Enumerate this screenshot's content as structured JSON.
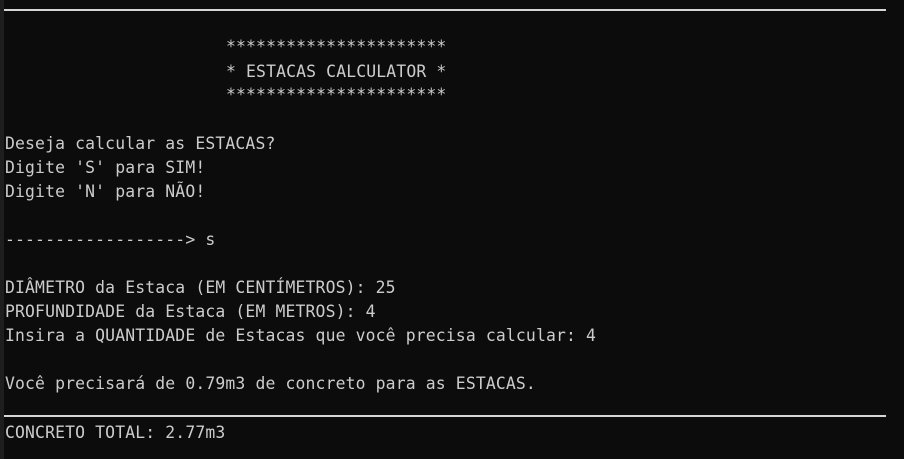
{
  "terminal": {
    "background": "#0c0c0c",
    "foreground": "#cccccc",
    "banner": {
      "top": "**********************",
      "title": "* ESTACAS CALCULATOR *",
      "bottom": "**********************"
    },
    "prompt": {
      "question": "Deseja calcular as ESTACAS?",
      "option_yes": "Digite 'S' para SIM!",
      "option_no": "Digite 'N' para NÃO!"
    },
    "answer": {
      "arrow": "------------------>",
      "value": "s"
    },
    "inputs": {
      "diameter_line": "DIÂMETRO da Estaca (EM CENTÍMETROS): 25",
      "depth_line": "PROFUNDIDADE da Estaca (EM METROS): 4",
      "quantity_line": "Insira a QUANTIDADE de Estacas que você precisa calcular: 4"
    },
    "result": "Você precisará de 0.79m3 de concreto para as ESTACAS.",
    "total": "CONCRETO TOTAL: 2.77m3"
  }
}
